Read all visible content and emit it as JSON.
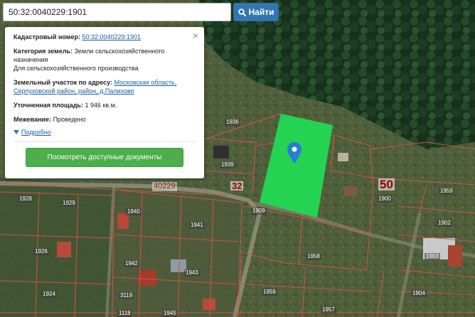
{
  "search": {
    "value": "50:32:0040229:1901",
    "button_label": "Найти"
  },
  "popup": {
    "cadastral_label": "Кадастровый номер:",
    "cadastral_value": "50:32:0040229:1901",
    "category_label": "Категория земель:",
    "category_value": "Земли сельскохозяйственного назначения",
    "usage_value": "Для сельскохозяйственного производства",
    "address_label": "Земельный участок по адресу:",
    "address_value": "Московская область, Серпуховской район, район, д.Палихово",
    "area_label": "Уточненная площадь:",
    "area_value": "1 946 кв.м.",
    "survey_label": "Межевание:",
    "survey_value": "Проведено",
    "details_label": "Подробно",
    "docs_button": "Посмотреть доступные документы",
    "close_symbol": "×"
  },
  "map": {
    "selected_plot_color": "#22dd55",
    "boundary_color": "#d9534f",
    "marker_color": "#2b7cd3",
    "block_labels": [
      "32",
      "50"
    ],
    "quarter_label": "40229",
    "plot_labels": [
      "1936",
      "1939",
      "1909",
      "1900",
      "1959",
      "1902",
      "1958",
      "1903",
      "1928",
      "1929",
      "1940",
      "1941",
      "1926",
      "1942",
      "1943",
      "1924",
      "1956",
      "1957",
      "1904",
      "3119",
      "1118",
      "1945"
    ]
  }
}
